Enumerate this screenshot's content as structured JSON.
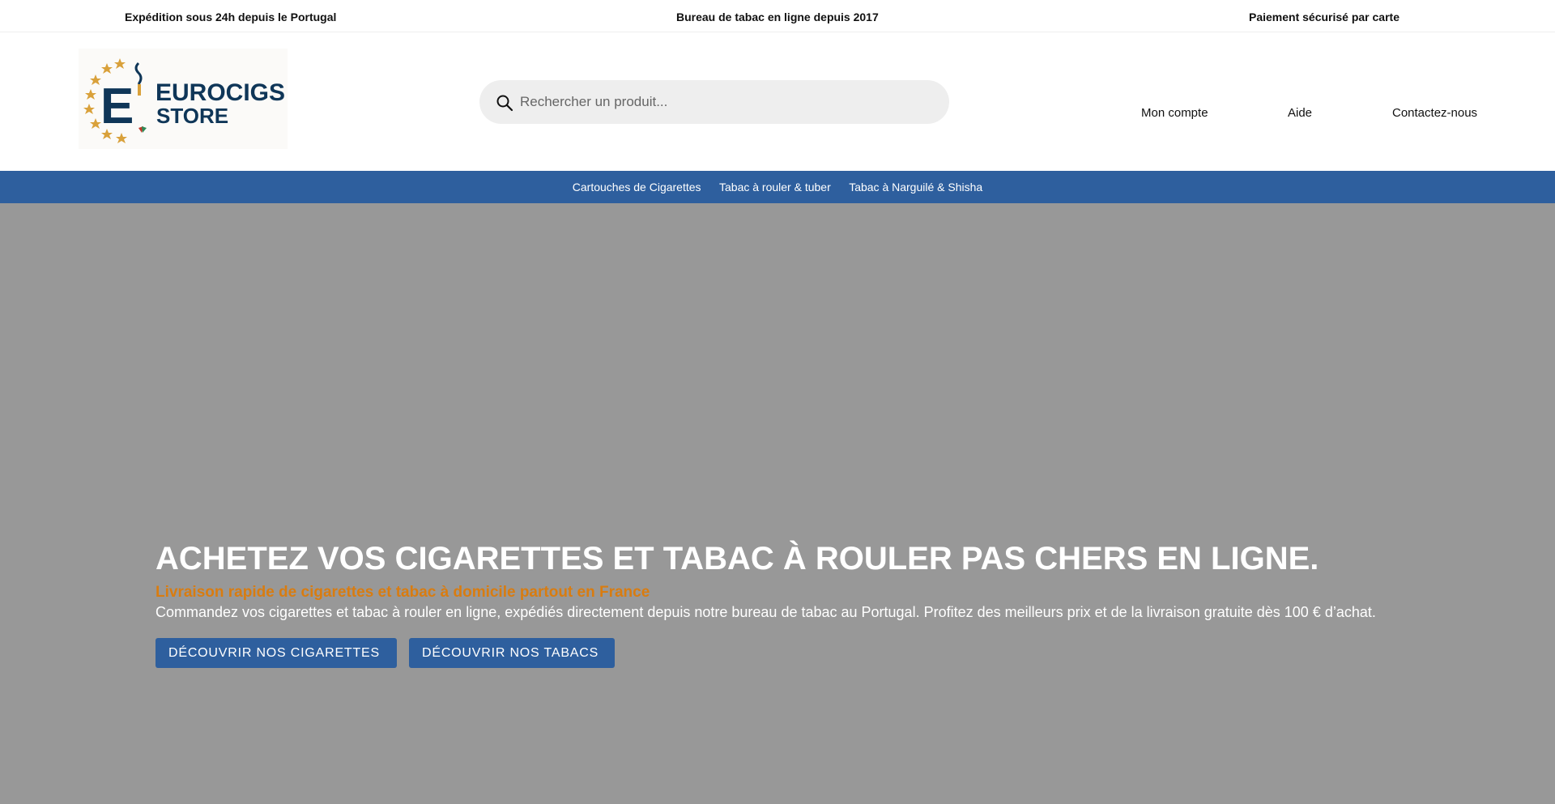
{
  "topbar": {
    "item1": "Expédition sous 24h depuis le Portugal",
    "item2": "Bureau de tabac en ligne depuis 2017",
    "item3": "Paiement sécurisé par carte"
  },
  "logo": {
    "line1": "EUROCIGS",
    "line2": "STORE",
    "letter": "E"
  },
  "search": {
    "placeholder": "Rechercher un produit..."
  },
  "header_nav": {
    "account": "Mon compte",
    "help": "Aide",
    "contact": "Contactez-nous"
  },
  "categories": [
    "Cartouches de Cigarettes",
    "Tabac à rouler & tuber",
    "Tabac à Narguilé & Shisha"
  ],
  "hero": {
    "title": "ACHETEZ VOS CIGARETTES ET TABAC À ROULER PAS CHERS EN LIGNE.",
    "subtitle": "Livraison rapide de cigarettes et tabac à domicile partout en France",
    "description": "Commandez vos cigarettes et tabac à rouler en ligne, expédiés directement depuis notre bureau de tabac au Portugal. Profitez des meilleurs prix et de la livraison gratuite dès 100 € d’achat.",
    "button1": "DÉCOUVRIR NOS CIGARETTES",
    "button2": "DÉCOUVRIR NOS TABACS"
  },
  "colors": {
    "brand_blue": "#2e5f9e",
    "accent_orange": "#d97c10",
    "hero_bg": "#989898",
    "logo_navy": "#0f3658",
    "logo_gold": "#d9a13b"
  }
}
